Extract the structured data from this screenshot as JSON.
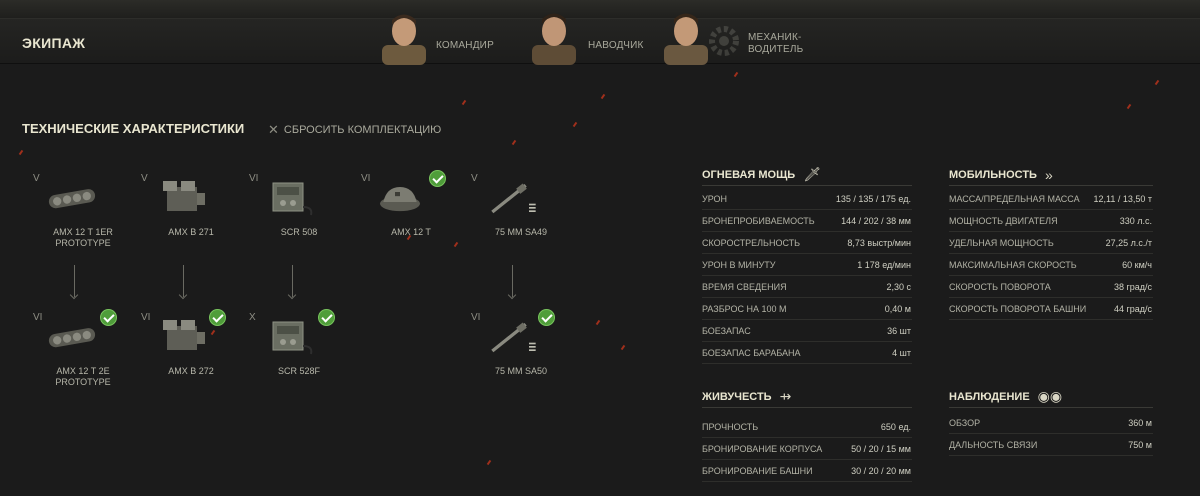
{
  "crew": {
    "title": "ЭКИПАЖ",
    "members": [
      {
        "role": "КОМАНДИР"
      },
      {
        "role": "НАВОДЧИК"
      },
      {
        "role": "МЕХАНИК-",
        "role2": "ВОДИТЕЛЬ"
      }
    ]
  },
  "specs": {
    "title": "ТЕХНИЧЕСКИЕ ХАРАКТЕРИСТИКИ",
    "reset_label": "СБРОСИТЬ КОМПЛЕКТАЦИЮ"
  },
  "modules": {
    "top": [
      {
        "tier": "V",
        "name": "AMX 12 T 1ER",
        "name2": "PROTOTYPE",
        "icon": "tracks-icon",
        "installed": false
      },
      {
        "tier": "V",
        "name": "AMX B 271",
        "name2": "",
        "icon": "engine-icon",
        "installed": false
      },
      {
        "tier": "VI",
        "name": "SCR 508",
        "name2": "",
        "icon": "radio-icon",
        "installed": false
      },
      {
        "tier": "VI",
        "name": "AMX 12 T",
        "name2": "",
        "icon": "turret-icon",
        "installed": true
      },
      {
        "tier": "V",
        "name": "75 MM SA49",
        "name2": "",
        "icon": "gun-icon",
        "installed": false
      }
    ],
    "bottom": [
      {
        "tier": "VI",
        "name": "AMX 12 T 2E",
        "name2": "PROTOTYPE",
        "icon": "tracks-icon",
        "installed": true
      },
      {
        "tier": "VI",
        "name": "AMX B 272",
        "name2": "",
        "icon": "engine-icon",
        "installed": true
      },
      {
        "tier": "X",
        "name": "SCR 528F",
        "name2": "",
        "icon": "radio-icon",
        "installed": true
      },
      {
        "tier": "VI",
        "name": "75 MM SA50",
        "name2": "",
        "icon": "gun-icon",
        "installed": true
      }
    ]
  },
  "firepower": {
    "title": "ОГНЕВАЯ МОЩЬ",
    "icon": "sword-icon",
    "rows": [
      {
        "label": "УРОН",
        "value": "135 / 135 / 175 ед."
      },
      {
        "label": "БРОНЕПРОБИВАЕМОСТЬ",
        "value": "144 / 202 / 38 мм"
      },
      {
        "label": "СКОРОСТРЕЛЬНОСТЬ",
        "value": "8,73 выстр/мин"
      },
      {
        "label": "УРОН В МИНУТУ",
        "value": "1 178 ед/мин"
      },
      {
        "label": "ВРЕМЯ СВЕДЕНИЯ",
        "value": "2,30 с"
      },
      {
        "label": "РАЗБРОС НА 100 М",
        "value": "0,40 м"
      },
      {
        "label": "БОЕЗАПАС",
        "value": "36 шт"
      },
      {
        "label": "БОЕЗАПАС БАРАБАНА",
        "value": "4 шт"
      }
    ]
  },
  "mobility": {
    "title": "МОБИЛЬНОСТЬ",
    "icon": "double-chevron-icon",
    "rows": [
      {
        "label": "МАССА/ПРЕДЕЛЬНАЯ МАССА",
        "value": "12,11 / 13,50 т"
      },
      {
        "label": "МОЩНОСТЬ ДВИГАТЕЛЯ",
        "value": "330 л.с."
      },
      {
        "label": "УДЕЛЬНАЯ МОЩНОСТЬ",
        "value": "27,25 л.с./т"
      },
      {
        "label": "МАКСИМАЛЬНАЯ СКОРОСТЬ",
        "value": "60 км/ч"
      },
      {
        "label": "СКОРОСТЬ ПОВОРОТА",
        "value": "38 град/с"
      },
      {
        "label": "СКОРОСТЬ ПОВОРОТА БАШНИ",
        "value": "44 град/с"
      }
    ]
  },
  "survivability": {
    "title": "ЖИВУЧЕСТЬ",
    "icon": "armor-icon",
    "rows": [
      {
        "label": "ПРОЧНОСТЬ",
        "value": "650 ед."
      },
      {
        "label": "БРОНИРОВАНИЕ КОРПУСА",
        "value": "50 / 20 / 15 мм"
      },
      {
        "label": "БРОНИРОВАНИЕ БАШНИ",
        "value": "30 / 20 / 20 мм"
      }
    ]
  },
  "observation": {
    "title": "НАБЛЮДЕНИЕ",
    "icon": "binoculars-icon",
    "rows": [
      {
        "label": "ОБЗОР",
        "value": "360 м"
      },
      {
        "label": "ДАЛЬНОСТЬ СВЯЗИ",
        "value": "750 м"
      }
    ]
  }
}
